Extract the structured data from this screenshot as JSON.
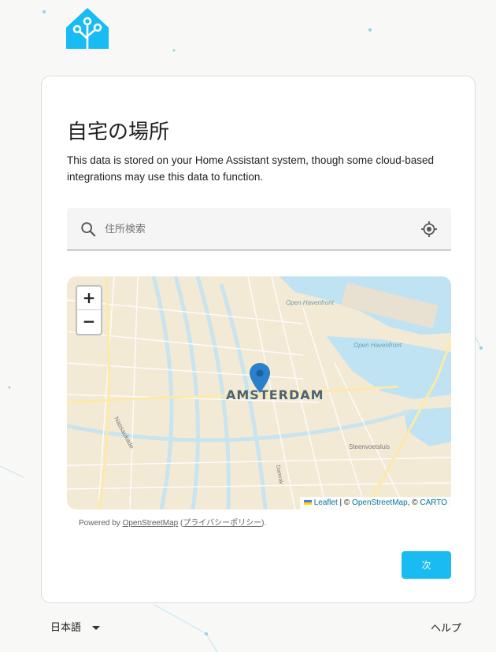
{
  "header": {
    "logo_icon": "home-assistant-logo-icon"
  },
  "card": {
    "title": "自宅の場所",
    "description": "This data is stored on your Home Assistant system, though some cloud-based integrations may use this data to function."
  },
  "search": {
    "placeholder": "住所検索",
    "value": "",
    "search_icon": "search-icon",
    "locate_icon": "my-location-icon"
  },
  "map": {
    "city_label": "AMSTERDAM",
    "place_labels": [
      "Open Havenfront",
      "Open Havenfront",
      "Nassaukade",
      "Steenvoetsluis",
      "Damrak"
    ],
    "zoom_in_label": "+",
    "zoom_out_label": "−",
    "attribution": {
      "leaflet": "Leaflet",
      "separator1": " | © ",
      "osm": "OpenStreetMap",
      "separator2": ", © ",
      "carto": "CARTO"
    }
  },
  "powered": {
    "prefix": "Powered by ",
    "link": "OpenStreetMap",
    "paren_open": " (",
    "privacy": "プライバシーポリシー",
    "paren_close": ")."
  },
  "actions": {
    "next_label": "次"
  },
  "footer": {
    "language": "日本語",
    "help": "ヘルプ"
  },
  "colors": {
    "accent": "#18bcf2",
    "brand": "#18bcf2",
    "map_water": "#bfe3f2",
    "pin": "#2a81cb"
  }
}
